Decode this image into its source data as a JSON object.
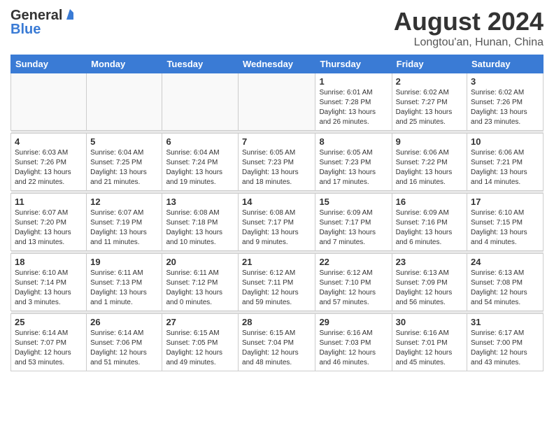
{
  "logo": {
    "general": "General",
    "blue": "Blue"
  },
  "title": "August 2024",
  "location": "Longtou'an, Hunan, China",
  "days_of_week": [
    "Sunday",
    "Monday",
    "Tuesday",
    "Wednesday",
    "Thursday",
    "Friday",
    "Saturday"
  ],
  "weeks": [
    [
      {
        "day": "",
        "info": ""
      },
      {
        "day": "",
        "info": ""
      },
      {
        "day": "",
        "info": ""
      },
      {
        "day": "",
        "info": ""
      },
      {
        "day": "1",
        "info": "Sunrise: 6:01 AM\nSunset: 7:28 PM\nDaylight: 13 hours\nand 26 minutes."
      },
      {
        "day": "2",
        "info": "Sunrise: 6:02 AM\nSunset: 7:27 PM\nDaylight: 13 hours\nand 25 minutes."
      },
      {
        "day": "3",
        "info": "Sunrise: 6:02 AM\nSunset: 7:26 PM\nDaylight: 13 hours\nand 23 minutes."
      }
    ],
    [
      {
        "day": "4",
        "info": "Sunrise: 6:03 AM\nSunset: 7:26 PM\nDaylight: 13 hours\nand 22 minutes."
      },
      {
        "day": "5",
        "info": "Sunrise: 6:04 AM\nSunset: 7:25 PM\nDaylight: 13 hours\nand 21 minutes."
      },
      {
        "day": "6",
        "info": "Sunrise: 6:04 AM\nSunset: 7:24 PM\nDaylight: 13 hours\nand 19 minutes."
      },
      {
        "day": "7",
        "info": "Sunrise: 6:05 AM\nSunset: 7:23 PM\nDaylight: 13 hours\nand 18 minutes."
      },
      {
        "day": "8",
        "info": "Sunrise: 6:05 AM\nSunset: 7:23 PM\nDaylight: 13 hours\nand 17 minutes."
      },
      {
        "day": "9",
        "info": "Sunrise: 6:06 AM\nSunset: 7:22 PM\nDaylight: 13 hours\nand 16 minutes."
      },
      {
        "day": "10",
        "info": "Sunrise: 6:06 AM\nSunset: 7:21 PM\nDaylight: 13 hours\nand 14 minutes."
      }
    ],
    [
      {
        "day": "11",
        "info": "Sunrise: 6:07 AM\nSunset: 7:20 PM\nDaylight: 13 hours\nand 13 minutes."
      },
      {
        "day": "12",
        "info": "Sunrise: 6:07 AM\nSunset: 7:19 PM\nDaylight: 13 hours\nand 11 minutes."
      },
      {
        "day": "13",
        "info": "Sunrise: 6:08 AM\nSunset: 7:18 PM\nDaylight: 13 hours\nand 10 minutes."
      },
      {
        "day": "14",
        "info": "Sunrise: 6:08 AM\nSunset: 7:17 PM\nDaylight: 13 hours\nand 9 minutes."
      },
      {
        "day": "15",
        "info": "Sunrise: 6:09 AM\nSunset: 7:17 PM\nDaylight: 13 hours\nand 7 minutes."
      },
      {
        "day": "16",
        "info": "Sunrise: 6:09 AM\nSunset: 7:16 PM\nDaylight: 13 hours\nand 6 minutes."
      },
      {
        "day": "17",
        "info": "Sunrise: 6:10 AM\nSunset: 7:15 PM\nDaylight: 13 hours\nand 4 minutes."
      }
    ],
    [
      {
        "day": "18",
        "info": "Sunrise: 6:10 AM\nSunset: 7:14 PM\nDaylight: 13 hours\nand 3 minutes."
      },
      {
        "day": "19",
        "info": "Sunrise: 6:11 AM\nSunset: 7:13 PM\nDaylight: 13 hours\nand 1 minute."
      },
      {
        "day": "20",
        "info": "Sunrise: 6:11 AM\nSunset: 7:12 PM\nDaylight: 13 hours\nand 0 minutes."
      },
      {
        "day": "21",
        "info": "Sunrise: 6:12 AM\nSunset: 7:11 PM\nDaylight: 12 hours\nand 59 minutes."
      },
      {
        "day": "22",
        "info": "Sunrise: 6:12 AM\nSunset: 7:10 PM\nDaylight: 12 hours\nand 57 minutes."
      },
      {
        "day": "23",
        "info": "Sunrise: 6:13 AM\nSunset: 7:09 PM\nDaylight: 12 hours\nand 56 minutes."
      },
      {
        "day": "24",
        "info": "Sunrise: 6:13 AM\nSunset: 7:08 PM\nDaylight: 12 hours\nand 54 minutes."
      }
    ],
    [
      {
        "day": "25",
        "info": "Sunrise: 6:14 AM\nSunset: 7:07 PM\nDaylight: 12 hours\nand 53 minutes."
      },
      {
        "day": "26",
        "info": "Sunrise: 6:14 AM\nSunset: 7:06 PM\nDaylight: 12 hours\nand 51 minutes."
      },
      {
        "day": "27",
        "info": "Sunrise: 6:15 AM\nSunset: 7:05 PM\nDaylight: 12 hours\nand 49 minutes."
      },
      {
        "day": "28",
        "info": "Sunrise: 6:15 AM\nSunset: 7:04 PM\nDaylight: 12 hours\nand 48 minutes."
      },
      {
        "day": "29",
        "info": "Sunrise: 6:16 AM\nSunset: 7:03 PM\nDaylight: 12 hours\nand 46 minutes."
      },
      {
        "day": "30",
        "info": "Sunrise: 6:16 AM\nSunset: 7:01 PM\nDaylight: 12 hours\nand 45 minutes."
      },
      {
        "day": "31",
        "info": "Sunrise: 6:17 AM\nSunset: 7:00 PM\nDaylight: 12 hours\nand 43 minutes."
      }
    ]
  ]
}
